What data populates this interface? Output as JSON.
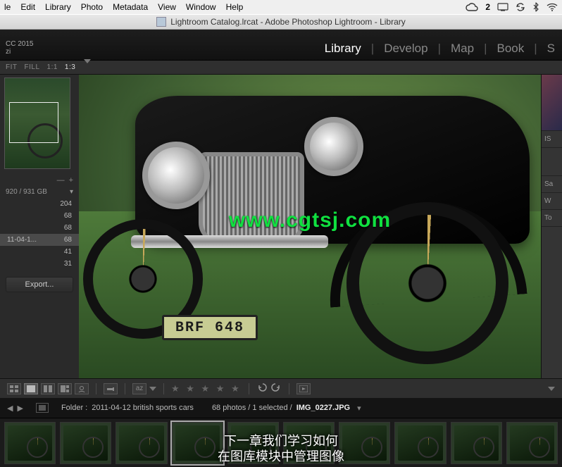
{
  "os_menu": {
    "items": [
      "le",
      "Edit",
      "Library",
      "Photo",
      "Metadata",
      "View",
      "Window",
      "Help"
    ],
    "cc_badge": "2"
  },
  "title_bar": {
    "text": "Lightroom Catalog.lrcat - Adobe Photoshop Lightroom - Library"
  },
  "module_header": {
    "tag": "CC 2015",
    "subtag": "zi",
    "tabs": [
      "Library",
      "Develop",
      "Map",
      "Book",
      "S"
    ],
    "active": "Library"
  },
  "left_toolbar": {
    "items": [
      "FIT",
      "FILL",
      "1:1",
      "1:3"
    ],
    "active": "1:3"
  },
  "catalog": {
    "gb": "920 / 931 GB",
    "rows": [
      {
        "label": "",
        "count": "204"
      },
      {
        "label": "",
        "count": "68"
      },
      {
        "label": "",
        "count": "68"
      },
      {
        "label": "11-04-1...",
        "count": "68",
        "selected": true
      },
      {
        "label": "",
        "count": "41"
      },
      {
        "label": "",
        "count": "31"
      }
    ],
    "export": "Export..."
  },
  "right_panel": {
    "stubs": [
      "",
      "IS",
      "",
      "Sa",
      "W",
      "To"
    ]
  },
  "photo": {
    "plate": "BRF 648",
    "watermark": "www.cgtsj.com"
  },
  "view_toolbar": {
    "modes": [
      "grid",
      "loupe",
      "compare",
      "survey",
      "people"
    ],
    "active": "loupe"
  },
  "status": {
    "chev_left": "",
    "folder_label": "Folder :",
    "folder": "2011-04-12 british sports cars",
    "count": "68 photos / 1 selected /",
    "file": "IMG_0227.JPG"
  },
  "subtitle": {
    "line1": "下一章我们学习如何",
    "line2": "在图库模块中管理图像"
  }
}
